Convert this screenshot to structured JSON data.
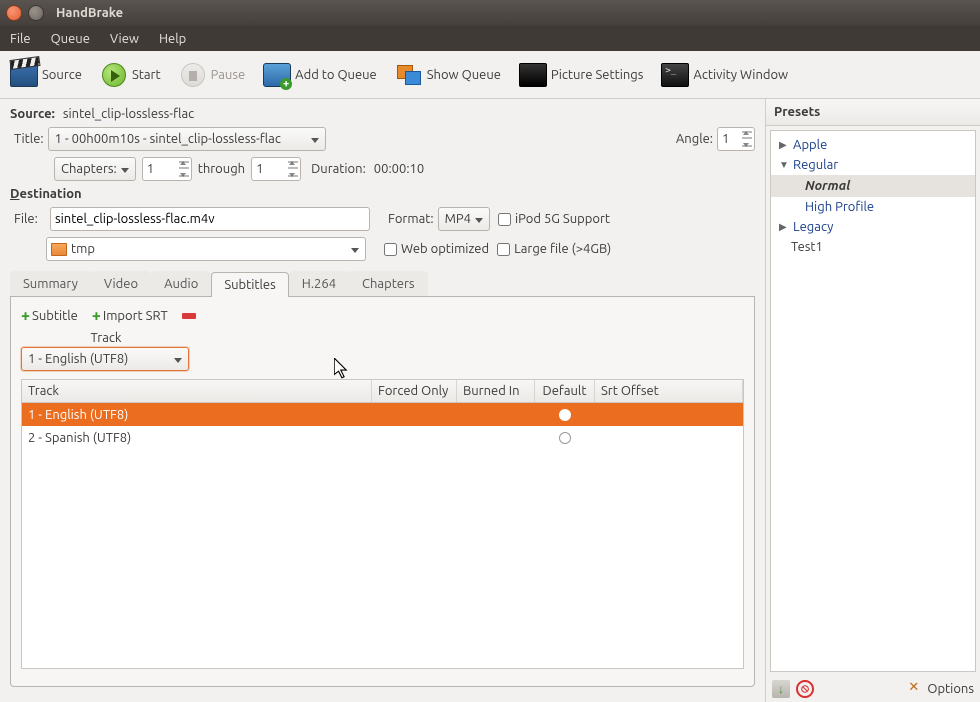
{
  "window": {
    "title": "HandBrake"
  },
  "menu": {
    "file": "File",
    "queue": "Queue",
    "view": "View",
    "help": "Help"
  },
  "toolbar": {
    "source": "Source",
    "start": "Start",
    "pause": "Pause",
    "add_queue": "Add to Queue",
    "show_queue": "Show Queue",
    "picture": "Picture Settings",
    "activity": "Activity Window"
  },
  "source": {
    "label": "Source:",
    "value": "sintel_clip-lossless-flac",
    "title_label": "Title:",
    "title_value": "1 - 00h00m10s - sintel_clip-lossless-flac",
    "angle_label": "Angle:",
    "angle_value": "1",
    "chapters_label": "Chapters:",
    "chap_from": "1",
    "through": "through",
    "chap_to": "1",
    "duration_label": "Duration:",
    "duration_value": "00:00:10"
  },
  "dest": {
    "heading": "Destination",
    "file_label": "File:",
    "file_value": "sintel_clip-lossless-flac.m4v",
    "folder": "tmp",
    "format_label": "Format:",
    "format_value": "MP4",
    "ipod": "iPod 5G Support",
    "web": "Web optimized",
    "large": "Large file (>4GB)"
  },
  "tabs": {
    "summary": "Summary",
    "video": "Video",
    "audio": "Audio",
    "subtitles": "Subtitles",
    "h264": "H.264",
    "chapters": "Chapters"
  },
  "subs": {
    "add": "Subtitle",
    "import": "Import SRT",
    "track_label": "Track",
    "track_combo": "1 - English (UTF8)",
    "col_track": "Track",
    "col_forced": "Forced Only",
    "col_burned": "Burned In",
    "col_default": "Default",
    "col_offset": "Srt Offset",
    "rows": [
      {
        "track": "1 - English (UTF8)",
        "default": true
      },
      {
        "track": "2 - Spanish (UTF8)",
        "default": false
      }
    ]
  },
  "presets": {
    "heading": "Presets",
    "apple": "Apple",
    "regular": "Regular",
    "normal": "Normal",
    "high": "High Profile",
    "legacy": "Legacy",
    "test1": "Test1",
    "options": "Options"
  }
}
